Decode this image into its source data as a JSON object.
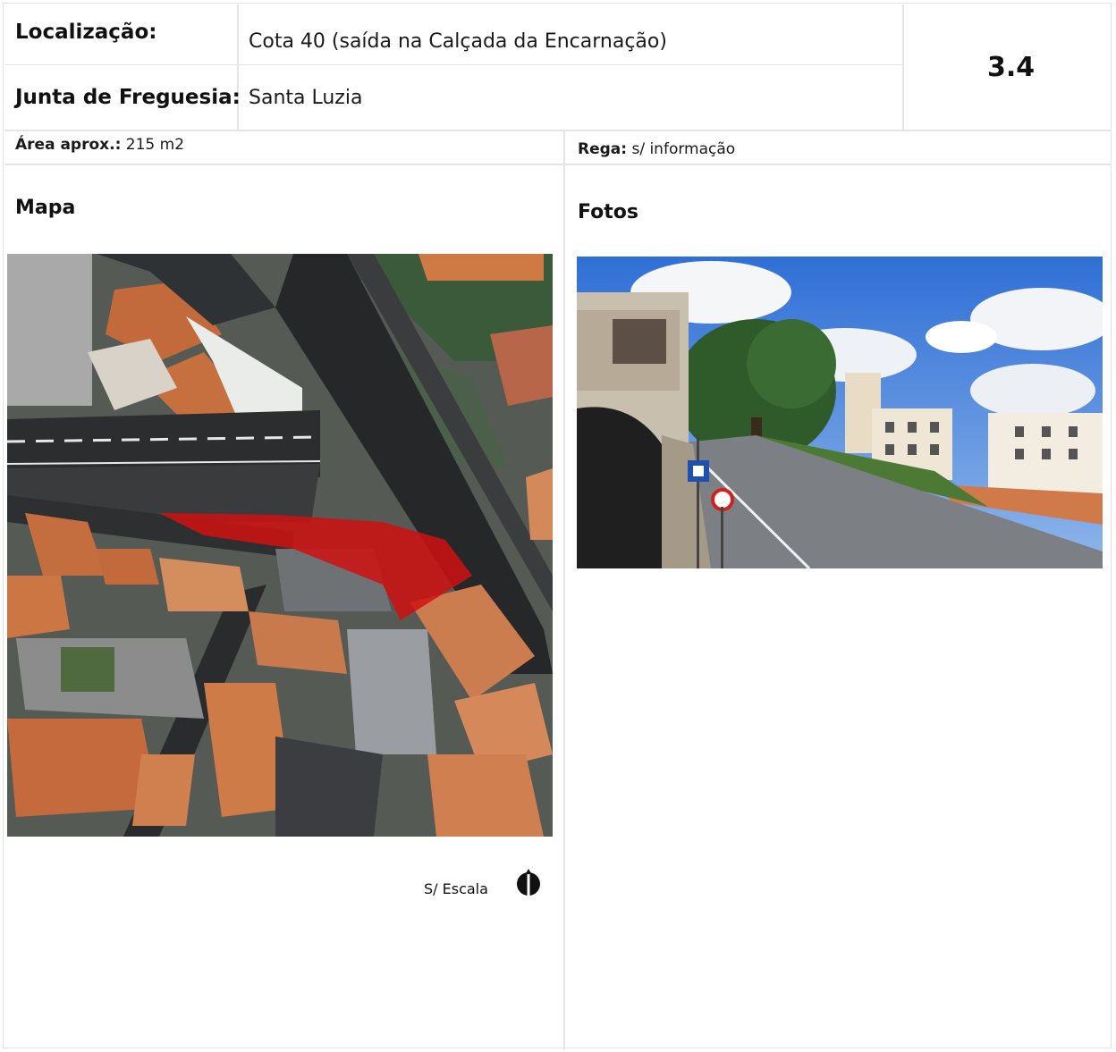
{
  "header": {
    "localizacao_label": "Localização:",
    "localizacao_value": "Cota 40 (saída na Calçada da Encarnação)",
    "junta_label": "Junta de Freguesia:",
    "junta_value": "Santa Luzia",
    "code": "3.4"
  },
  "info": {
    "area_label": "Área aprox.:",
    "area_value": "215 m2",
    "rega_label": "Rega:",
    "rega_value": "s/ informação"
  },
  "map": {
    "title": "Mapa",
    "scale_text": "S/ Escala",
    "north_icon": "north-arrow-icon",
    "highlight_color": "#d01010"
  },
  "photos": {
    "title": "Fotos"
  }
}
